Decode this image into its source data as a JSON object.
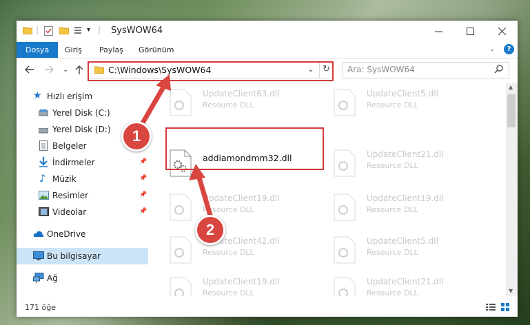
{
  "window": {
    "title": "SysWOW64"
  },
  "ribbon": {
    "tabs": [
      "Dosya",
      "Giriş",
      "Paylaş",
      "Görünüm"
    ]
  },
  "address": {
    "path": "C:\\Windows\\SysWOW64"
  },
  "search": {
    "placeholder": "Ara: SysWOW64"
  },
  "sidebar": {
    "items": [
      {
        "label": "Hızlı erişim",
        "icon": "star-icon"
      },
      {
        "label": "Yerel Disk (C:)",
        "icon": "drive-icon"
      },
      {
        "label": "Yerel Disk (D:)",
        "icon": "drive-icon"
      },
      {
        "label": "Belgeler",
        "icon": "documents-icon"
      },
      {
        "label": "İndirmeler",
        "icon": "download-icon"
      },
      {
        "label": "Müzik",
        "icon": "music-icon"
      },
      {
        "label": "Resimler",
        "icon": "pictures-icon"
      },
      {
        "label": "Videolar",
        "icon": "videos-icon"
      },
      {
        "label": "OneDrive",
        "icon": "cloud-icon"
      },
      {
        "label": "Bu bilgisayar",
        "icon": "computer-icon"
      },
      {
        "label": "Ağ",
        "icon": "network-icon"
      }
    ]
  },
  "files": {
    "highlighted": {
      "name": "addiamondmm32.dll"
    },
    "faded": [
      {
        "name": "UpdateClient63.dll",
        "type": "Resource DLL"
      },
      {
        "name": "UpdateClient5.dll",
        "type": "Resource DLL"
      },
      {
        "name": "UpdateClient21.dll",
        "type": "Resource DLL"
      },
      {
        "name": "UpdateClient19.dll",
        "type": "Resource DLL"
      },
      {
        "name": "UpdateClient19.dll",
        "type": "Resource DLL"
      },
      {
        "name": "UpdateClient42.dll",
        "type": "Resource DLL"
      },
      {
        "name": "UpdateClient5.dll",
        "type": "Resource DLL"
      },
      {
        "name": "UpdateClient19.dll",
        "type": "Resource DLL"
      },
      {
        "name": "UpdateClient21.dll",
        "type": "Resource DLL"
      }
    ]
  },
  "status": {
    "count": "171 öğe"
  },
  "annotations": {
    "badge1": "1",
    "badge2": "2",
    "accent": "#d9453f"
  }
}
